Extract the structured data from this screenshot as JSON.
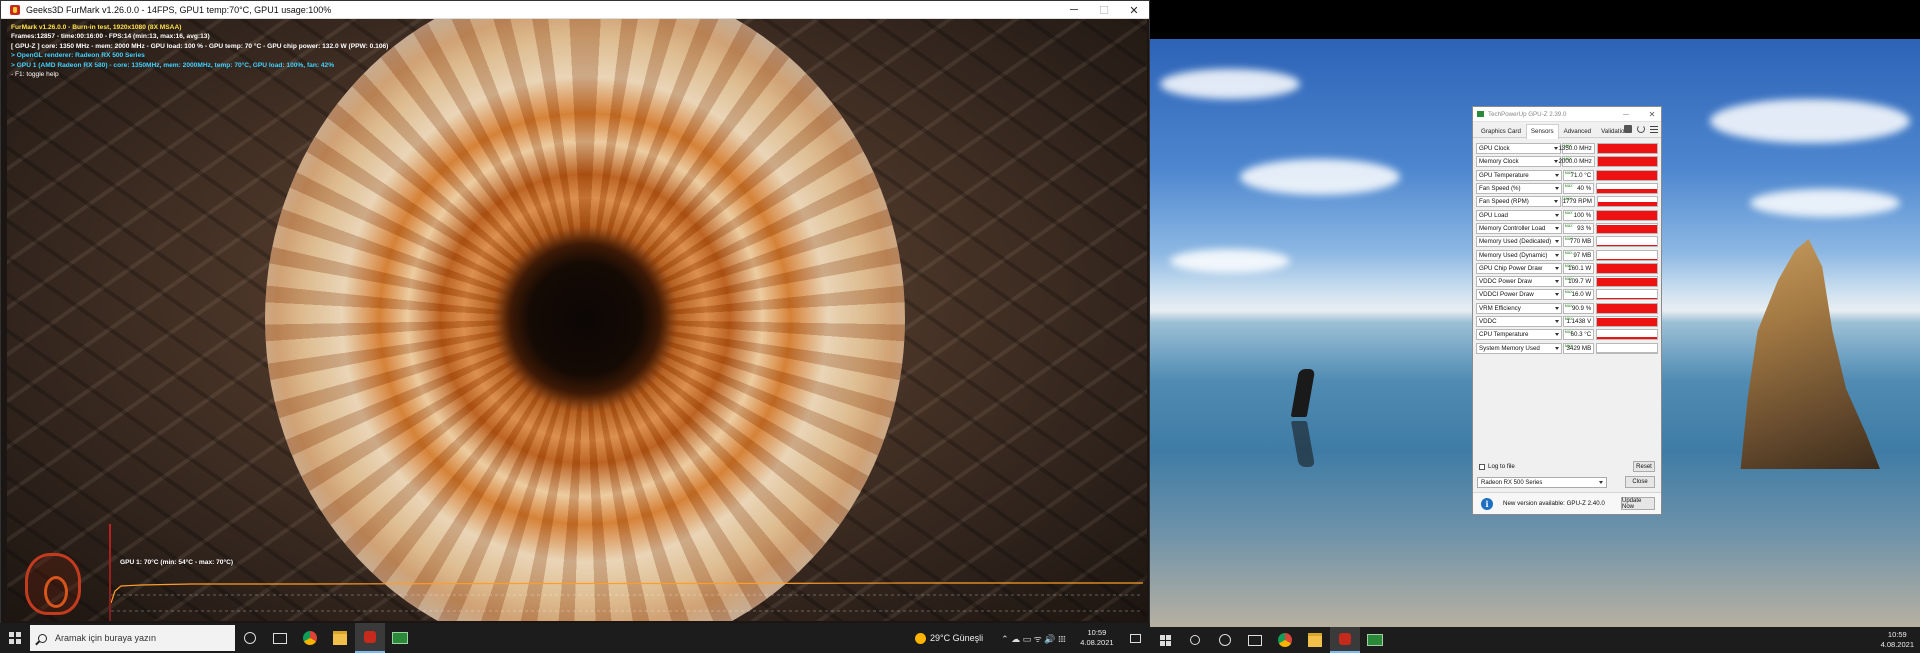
{
  "furmark": {
    "title": "Geeks3D FurMark v1.26.0.0 - 14FPS, GPU1 temp:70°C, GPU1 usage:100%",
    "osd": [
      "FurMark v1.26.0.0 - Burn-in test, 1920x1080 (8X MSAA)",
      "Frames:12857 - time:00:16:00 - FPS:14 (min:13, max:16, avg:13)",
      "[ GPU-Z ] core: 1350 MHz - mem: 2000 MHz - GPU load: 100 % - GPU temp: 70 °C - GPU chip power: 132.0 W (PPW: 0.106)",
      "> OpenGL renderer: Radeon RX 500 Series",
      "> GPU 1 (AMD Radeon RX 580) - core: 1350MHz, mem: 2000MHz, temp: 70°C, GPU load: 100%, fan: 42%",
      "- F1: toggle help"
    ],
    "graph_label": "GPU 1: 70°C (min: 54°C - max: 70°C)",
    "graph": {
      "temp_min": 54,
      "temp_max": 70,
      "temp_current": 70
    }
  },
  "taskbar_left": {
    "search_placeholder": "Aramak için buraya yazın",
    "weather": "29°C  Güneşli",
    "tray": "⌃  ☁  ▭  ᯤ  🔊  𝍖",
    "time": "10:59",
    "date": "4.08.2021"
  },
  "gpuz": {
    "title": "TechPowerUp GPU-Z 2.39.0",
    "tabs": [
      "Graphics Card",
      "Sensors",
      "Advanced",
      "Validation"
    ],
    "active_tab": "Sensors",
    "sensors": [
      {
        "name": "GPU Clock",
        "value": "1350.0 MHz",
        "level": 1.0
      },
      {
        "name": "Memory Clock",
        "value": "2000.0 MHz",
        "level": 1.0
      },
      {
        "name": "GPU Temperature",
        "value": "71.0 °C",
        "level": 1.0
      },
      {
        "name": "Fan Speed (%)",
        "value": "40 %",
        "level": 0.45
      },
      {
        "name": "Fan Speed (RPM)",
        "value": "1779 RPM",
        "level": 0.5
      },
      {
        "name": "GPU Load",
        "value": "100 %",
        "level": 1.0
      },
      {
        "name": "Memory Controller Load",
        "value": "93 %",
        "level": 0.93
      },
      {
        "name": "Memory Used (Dedicated)",
        "value": "770 MB",
        "level": 0.12
      },
      {
        "name": "Memory Used (Dynamic)",
        "value": "97 MB",
        "level": 0.04
      },
      {
        "name": "GPU Chip Power Draw",
        "value": "160.1 W",
        "level": 0.95
      },
      {
        "name": "VDDC Power Draw",
        "value": "109.7 W",
        "level": 0.95
      },
      {
        "name": "VDDCI Power Draw",
        "value": "16.0 W",
        "level": 0.2
      },
      {
        "name": "VRM Efficiency",
        "value": "90.9 %",
        "level": 1.0
      },
      {
        "name": "VDDC",
        "value": "1.1438 V",
        "level": 0.9
      },
      {
        "name": "CPU Temperature",
        "value": "60.3 °C",
        "level": 0.3
      },
      {
        "name": "System Memory Used",
        "value": "3429 MB",
        "level": 0.0
      }
    ],
    "max_tag": "MAX",
    "log_label": "Log to file",
    "reset_label": "Reset",
    "device": "Radeon RX 500 Series",
    "close_label": "Close",
    "update_text": "New version available: GPU-Z 2.40.0",
    "update_button": "Update Now"
  },
  "taskbar_right": {
    "time": "10:59",
    "date": "4.08.2021"
  }
}
